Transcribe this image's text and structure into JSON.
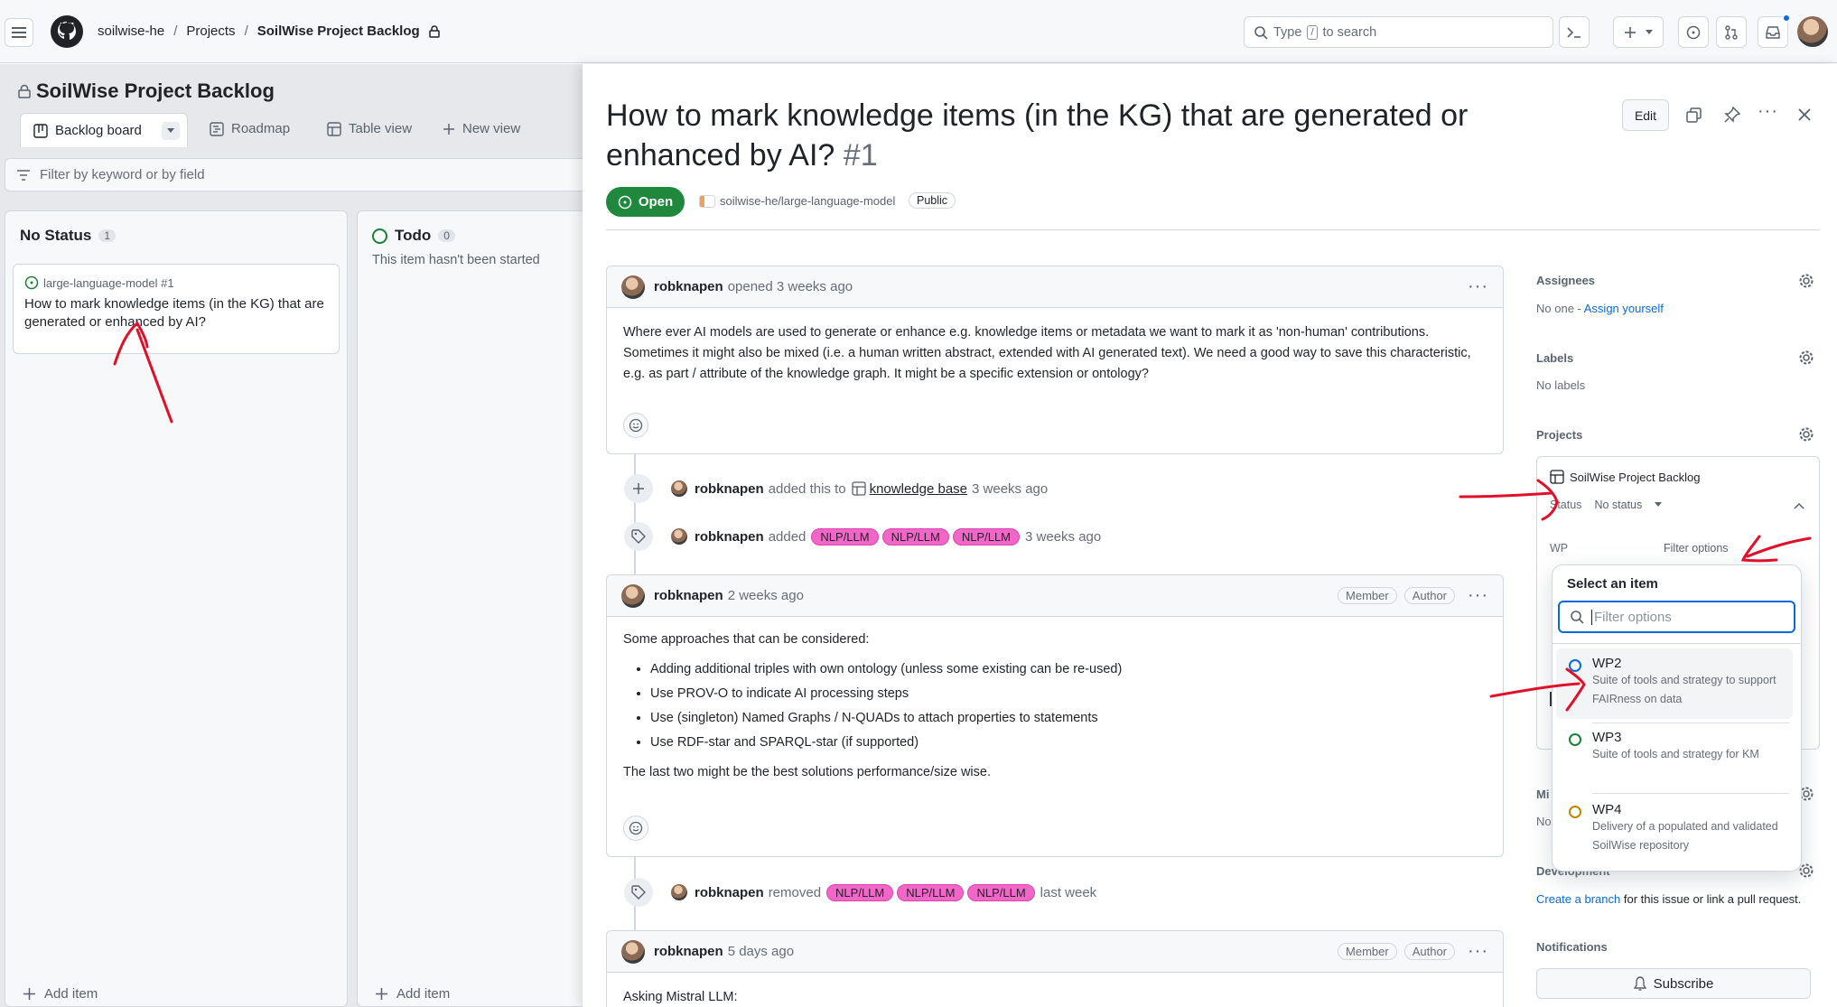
{
  "header": {
    "breadcrumb": [
      "soilwise-he",
      "Projects",
      "SoilWise Project Backlog"
    ],
    "search_placeholder_pre": "Type",
    "search_key": "/",
    "search_placeholder_post": "to search"
  },
  "project": {
    "title": "SoilWise Project Backlog",
    "views": [
      "Backlog board",
      "Roadmap",
      "Table view",
      "New view"
    ],
    "filter_placeholder": "Filter by keyword or by field",
    "columns": [
      {
        "name": "No Status",
        "count": "1"
      },
      {
        "name": "Todo",
        "count": "0",
        "description": "This item hasn't been started"
      }
    ],
    "card": {
      "repo": "large-language-model #1",
      "title": "How to mark knowledge items (in the KG) that are generated or enhanced by AI?"
    },
    "add_item": "Add item"
  },
  "issue": {
    "title": "How to mark knowledge items (in the KG) that are generated or enhanced by AI?",
    "number": "#1",
    "state": "Open",
    "repo": "soilwise-he/large-language-model",
    "visibility": "Public",
    "edit_label": "Edit"
  },
  "comments": {
    "c1": {
      "author": "robknapen",
      "meta": "opened 3 weeks ago",
      "body": "Where ever AI models are used to generate or enhance e.g. knowledge items or metadata we want to mark it as 'non-human' contributions. Sometimes it might also be mixed (i.e. a human written abstract, extended with AI generated text). We need a good way to save this characteristic, e.g. as part / attribute of the knowledge graph. It might be a specific extension or ontology?"
    },
    "c2": {
      "author": "robknapen",
      "meta": "2 weeks ago",
      "badge1": "Member",
      "badge2": "Author",
      "intro": "Some approaches that can be considered:",
      "items": [
        "Adding additional triples with own ontology (unless some existing can be re-used)",
        "Use PROV-O to indicate AI processing steps",
        "Use (singleton) Named Graphs / N-QUADs to attach properties to statements",
        "Use RDF-star and SPARQL-star (if supported)"
      ],
      "outro": "The last two might be the best solutions performance/size wise."
    },
    "c3": {
      "author": "robknapen",
      "meta": "5 days ago",
      "badge1": "Member",
      "badge2": "Author",
      "body": "Asking Mistral LLM:"
    }
  },
  "timeline": {
    "e1": {
      "author": "robknapen",
      "action": "added this to",
      "target": "knowledge base",
      "time": "3 weeks ago"
    },
    "e2": {
      "author": "robknapen",
      "action": "added",
      "labels": [
        "NLP/LLM",
        "NLP/LLM",
        "NLP/LLM"
      ],
      "time": "3 weeks ago"
    },
    "e3": {
      "author": "robknapen",
      "action": "removed",
      "labels": [
        "NLP/LLM",
        "NLP/LLM",
        "NLP/LLM"
      ],
      "time": "last week"
    }
  },
  "sidebar": {
    "assignees_title": "Assignees",
    "assignees_none": "No one - ",
    "assign_yourself": "Assign yourself",
    "labels_title": "Labels",
    "labels_none": "No labels",
    "projects_title": "Projects",
    "project_name": "SoilWise Project Backlog",
    "status_label": "Status",
    "status_value": "No status",
    "wp_label": "WP",
    "wp_value": "Filter options",
    "milestone_abbr": "Mi",
    "milestone_none_abbr": "No",
    "development_title": "Development",
    "create_branch": "Create a branch",
    "development_rest": "for this issue or link a pull request.",
    "notifications_title": "Notifications",
    "subscribe": "Subscribe"
  },
  "dropdown": {
    "title": "Select an item",
    "filter_placeholder": "Filter options",
    "options": [
      {
        "name": "WP2",
        "description": "Suite of tools and strategy to support FAIRness on data",
        "color": "#0969da"
      },
      {
        "name": "WP3",
        "description": "Suite of tools and strategy for KM",
        "color": "#1a7f37"
      },
      {
        "name": "WP4",
        "description": "Delivery of a populated and validated SoilWise repository",
        "color": "#bf8700"
      }
    ]
  },
  "colors": {
    "open_green": "#1f883d",
    "label_pink": "#f266c8",
    "annotation_red": "#e0102a"
  }
}
